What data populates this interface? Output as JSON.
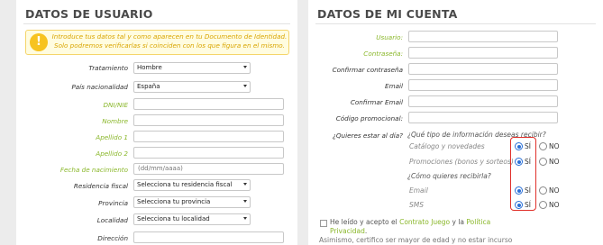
{
  "left": {
    "title": "DATOS DE USUARIO",
    "alert": "Introduce tus datos tal y como aparecen en tu Documento de Identidad. Solo podremos verificarlas si coinciden con los que figura en el mismo.",
    "labels": {
      "tratamiento": "Tratamiento",
      "pais": "País nacionalidad",
      "dni": "DNI/NIE",
      "nombre": "Nombre",
      "apellido1": "Apellido 1",
      "apellido2": "Apellido 2",
      "fecha": "Fecha de nacimiento",
      "residencia": "Residencia fiscal",
      "provincia": "Provincia",
      "localidad": "Localidad",
      "direccion": "Dirección"
    },
    "values": {
      "tratamiento": "Hombre",
      "pais": "España",
      "fecha_placeholder": "(dd/mm/aaaa)",
      "residencia": "Selecciona tu residencia fiscal",
      "provincia": "Selecciona tu provincia",
      "localidad": "Selecciona tu localidad"
    }
  },
  "right": {
    "title": "DATOS DE MI CUENTA",
    "labels": {
      "usuario": "Usuario:",
      "contrasena": "Contraseña:",
      "confirmar_contrasena": "Confirmar contraseña",
      "email": "Email",
      "confirmar_email": "Confirmar Email",
      "codigo": "Código promocional:",
      "estar_al_dia": "¿Quieres estar al día?",
      "tipo_info": "¿Qué tipo de información deseas recibir?",
      "como_recibirla": "¿Cómo quieres recibirla?"
    },
    "options": {
      "catalogo": "Catálogo y novedades",
      "promociones": "Promociones (bonos y sorteos)",
      "email": "Email",
      "sms": "SMS"
    },
    "radio": {
      "yes": "SÍ",
      "no": "NO"
    },
    "legal": {
      "prefix": "He leído y acepto el ",
      "link1": "Contrato Juego",
      "mid": " y la ",
      "link2": "Política Privacidad",
      "suffix": ".",
      "line2": "Asimismo, certifico ser mayor de edad y no estar incurso"
    }
  },
  "colors": {
    "accent_green": "#8ab72a",
    "alert_yellow": "#d9a500",
    "radio_blue": "#2a6fd6",
    "highlight_red": "#e0302a"
  }
}
